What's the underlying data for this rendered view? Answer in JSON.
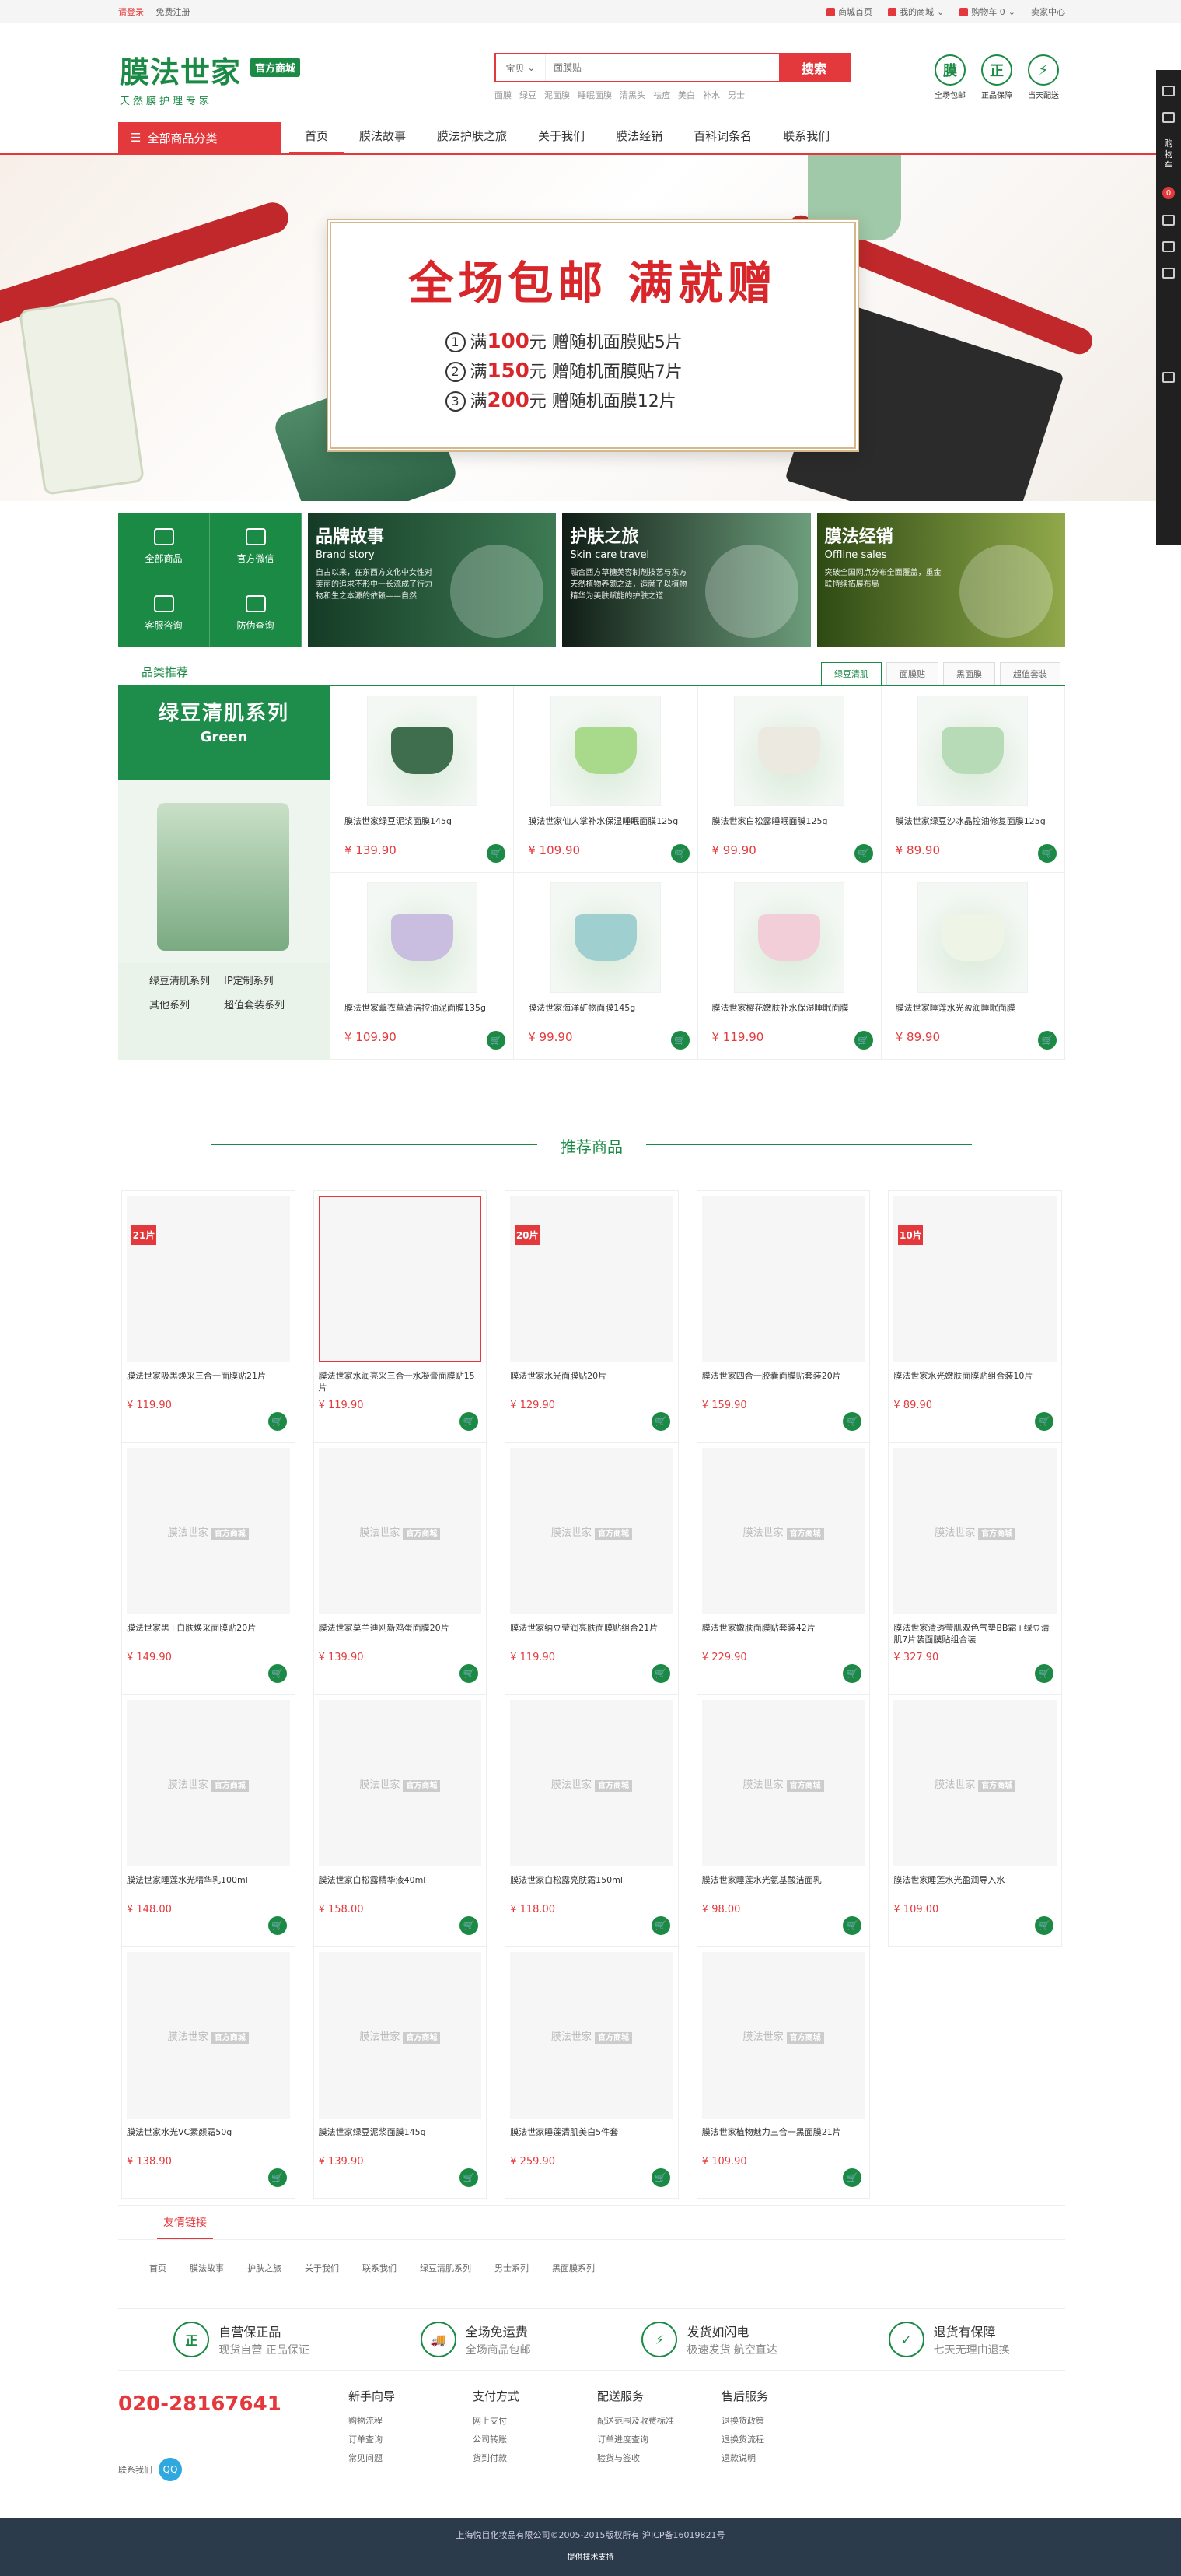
{
  "topbar": {
    "login": "请登录",
    "register": "免费注册",
    "links": [
      "商城首页",
      "我的商城",
      "购物车 0",
      "卖家中心"
    ]
  },
  "header": {
    "brand": "膜法世家",
    "badge": "官方商城",
    "slogan": "天然膜护理专家",
    "search_category": "宝贝",
    "search_placeholder": "面膜贴",
    "search_button": "搜索",
    "hot_words": [
      "面膜",
      "绿豆",
      "泥面膜",
      "睡眠面膜",
      "清黑头",
      "祛痘",
      "美白",
      "补水",
      "男士"
    ],
    "promises": [
      {
        "icon": "膜",
        "label": "全场包邮"
      },
      {
        "icon": "正",
        "label": "正品保障"
      },
      {
        "icon": "⚡",
        "label": "当天配送"
      }
    ]
  },
  "nav": {
    "all_categories": "全部商品分类",
    "items": [
      "首页",
      "膜法故事",
      "膜法护肤之旅",
      "关于我们",
      "膜法经销",
      "百科词条名",
      "联系我们"
    ]
  },
  "banner": {
    "headline": "全场包邮 满就赠",
    "offers": [
      {
        "num": "1",
        "pre": "满",
        "amount": "100",
        "post": "元 赠随机面膜贴5片"
      },
      {
        "num": "2",
        "pre": "满",
        "amount": "150",
        "post": "元 赠随机面膜贴7片"
      },
      {
        "num": "3",
        "pre": "满",
        "amount": "200",
        "post": "元 赠随机面膜12片"
      }
    ]
  },
  "quicklinks": [
    "全部商品",
    "官方微信",
    "客服咨询",
    "防伪查询"
  ],
  "stories": [
    {
      "title": "品牌故事",
      "en": "Brand story",
      "desc": "自古以来，在东西方文化中女性对美丽的追求不形中一长流成了行力物和生之本源的依赖——自然"
    },
    {
      "title": "护肤之旅",
      "en": "Skin care travel",
      "desc": "融合西方草糖美容制剂技艺与东方天然植物养颜之法，造就了以植物精华为美肤赋能的护肤之道"
    },
    {
      "title": "膜法经销",
      "en": "Offline sales",
      "desc": "突破全国网点分布全面覆盖，重金联持续拓展布局"
    }
  ],
  "category": {
    "title": "品类推荐",
    "tabs": [
      "绿豆清肌",
      "面膜贴",
      "黑面膜",
      "超值套装"
    ],
    "side_title": "绿豆清肌系列",
    "side_sub": "Green",
    "side_links": [
      "绿豆清肌系列",
      "IP定制系列",
      "其他系列",
      "超值套装系列"
    ],
    "products": [
      {
        "name": "膜法世家绿豆泥浆面膜145g",
        "price": "¥ 139.90",
        "color": "#3f6e4f"
      },
      {
        "name": "膜法世家仙人掌补水保湿睡眠面膜125g",
        "price": "¥ 109.90",
        "color": "#a9d98a"
      },
      {
        "name": "膜法世家白松露睡眠面膜125g",
        "price": "¥ 99.90",
        "color": "#eceae0"
      },
      {
        "name": "膜法世家绿豆沙冰晶控油修复面膜125g",
        "price": "¥ 89.90",
        "color": "#b7dbb7"
      },
      {
        "name": "膜法世家薰衣草清洁控油泥面膜135g",
        "price": "¥ 109.90",
        "color": "#c9bde0"
      },
      {
        "name": "膜法世家海洋矿物面膜145g",
        "price": "¥ 99.90",
        "color": "#9fcfcf"
      },
      {
        "name": "膜法世家樱花嫩肤补水保湿睡眠面膜",
        "price": "¥ 119.90",
        "color": "#f2cfd8"
      },
      {
        "name": "膜法世家睡莲水光盈润睡眠面膜",
        "price": "¥ 89.90",
        "color": "#eef5e6"
      }
    ]
  },
  "recommend": {
    "title": "推荐商品",
    "placeholder_brand": "膜法世家",
    "placeholder_badge": "官方商城",
    "products": [
      {
        "name": "膜法世家吸黑焕采三合一面膜贴21片",
        "price": "¥ 119.90",
        "photo": "photo1",
        "tag": "21片"
      },
      {
        "name": "膜法世家水润亮采三合一水凝膏面膜贴15片",
        "price": "¥ 119.90",
        "photo": "photo2",
        "tag": ""
      },
      {
        "name": "膜法世家水光面膜贴20片",
        "price": "¥ 129.90",
        "photo": "photo3",
        "tag": "20片"
      },
      {
        "name": "膜法世家四合一胶囊面膜贴套装20片",
        "price": "¥ 159.90",
        "photo": "photo4",
        "tag": ""
      },
      {
        "name": "膜法世家水光嫩肤面膜贴组合装10片",
        "price": "¥ 89.90",
        "photo": "photo5",
        "tag": "10片"
      },
      {
        "name": "膜法世家黑+白肤焕采面膜贴20片",
        "price": "¥ 149.90",
        "photo": "",
        "tag": ""
      },
      {
        "name": "膜法世家莫兰迪刚新鸡蛋面膜20片",
        "price": "¥ 139.90",
        "photo": "",
        "tag": ""
      },
      {
        "name": "膜法世家纳豆莹润亮肤面膜贴组合21片",
        "price": "¥ 119.90",
        "photo": "",
        "tag": ""
      },
      {
        "name": "膜法世家嫩肤面膜贴套装42片",
        "price": "¥ 229.90",
        "photo": "",
        "tag": ""
      },
      {
        "name": "膜法世家清透莹肌双色气垫BB霜+绿豆清肌7片装面膜贴组合装",
        "price": "¥ 327.90",
        "photo": "",
        "tag": ""
      },
      {
        "name": "膜法世家睡莲水光精华乳100ml",
        "price": "¥ 148.00",
        "photo": "",
        "tag": ""
      },
      {
        "name": "膜法世家白松露精华液40ml",
        "price": "¥ 158.00",
        "photo": "",
        "tag": ""
      },
      {
        "name": "膜法世家白松露亮肤霜150ml",
        "price": "¥ 118.00",
        "photo": "",
        "tag": ""
      },
      {
        "name": "膜法世家睡莲水光氨基酸洁面乳",
        "price": "¥ 98.00",
        "photo": "",
        "tag": ""
      },
      {
        "name": "膜法世家睡莲水光盈润导入水",
        "price": "¥ 109.00",
        "photo": "",
        "tag": ""
      },
      {
        "name": "膜法世家水光VC素颜霜50g",
        "price": "¥ 138.90",
        "photo": "",
        "tag": ""
      },
      {
        "name": "膜法世家绿豆泥浆面膜145g",
        "price": "¥ 139.90",
        "photo": "",
        "tag": ""
      },
      {
        "name": "膜法世家睡莲清肌美白5件套",
        "price": "¥ 259.90",
        "photo": "",
        "tag": ""
      },
      {
        "name": "膜法世家植物魅力三合一黑面膜21片",
        "price": "¥ 109.90",
        "photo": "",
        "tag": ""
      }
    ]
  },
  "friend_links": {
    "title": "友情链接",
    "items": [
      "首页",
      "膜法故事",
      "护肤之旅",
      "关于我们",
      "联系我们",
      "绿豆清肌系列",
      "男士系列",
      "黑面膜系列"
    ]
  },
  "services": [
    {
      "icon": "正",
      "title": "自营保正品",
      "sub": "现货自营 正品保证"
    },
    {
      "icon": "🚚",
      "title": "全场免运费",
      "sub": "全场商品包邮"
    },
    {
      "icon": "⚡",
      "title": "发货如闪电",
      "sub": "极速发货 航空直达"
    },
    {
      "icon": "✓",
      "title": "退货有保障",
      "sub": "七天无理由退换"
    }
  ],
  "footer": {
    "phone": "020-28167641",
    "contact": "联系我们",
    "qq_icon": "QQ",
    "columns": [
      {
        "head": "新手向导",
        "items": [
          "购物流程",
          "订单查询",
          "常见问题"
        ]
      },
      {
        "head": "支付方式",
        "items": [
          "网上支付",
          "公司转账",
          "货到付款"
        ]
      },
      {
        "head": "配送服务",
        "items": [
          "配送范围及收费标准",
          "订单进度查询",
          "验货与签收"
        ]
      },
      {
        "head": "售后服务",
        "items": [
          "退换货政策",
          "退换货流程",
          "退款说明"
        ]
      }
    ],
    "copyright": "上海悦目化妆品有限公司©2005-2015版权所有 沪ICP备16019821号",
    "tech": "提供技术支持"
  },
  "rightbar": {
    "cart_label": "购物车",
    "cart_count": "0"
  }
}
